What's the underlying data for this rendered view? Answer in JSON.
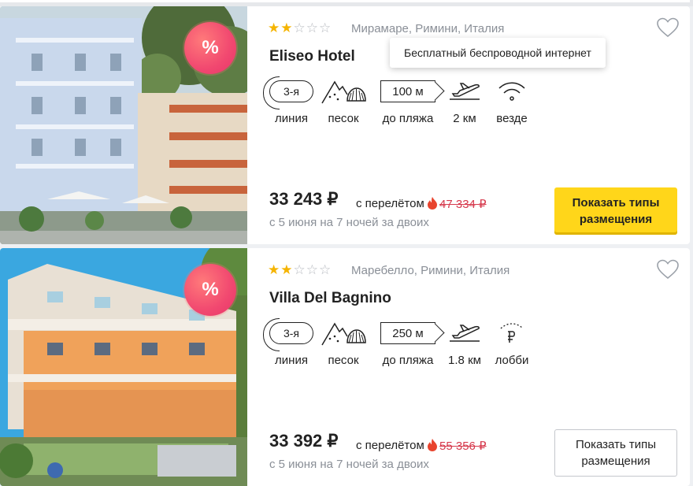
{
  "hotels": [
    {
      "stars_filled": 2,
      "stars_total": 5,
      "location": "Мирамаре, Римини, Италия",
      "name": "Eliseo Hotel",
      "discount_badge": "%",
      "features": {
        "line_value": "3-я",
        "line_label": "линия",
        "beach_label": "песок",
        "distance_value": "100 м",
        "distance_label": "до пляжа",
        "airport_label": "2 км",
        "wifi_label": "везде"
      },
      "tooltip": "Бесплатный беспроводной интернет",
      "price": "33 243 ₽",
      "price_note": "с перелётом",
      "old_price": "47 334 ₽",
      "dates": "с 5 июня на 7 ночей за двоих",
      "button_label": "Показать типы размещения"
    },
    {
      "stars_filled": 2,
      "stars_total": 5,
      "location": "Маребелло, Римини, Италия",
      "name": "Villa Del Bagnino",
      "discount_badge": "%",
      "features": {
        "line_value": "3-я",
        "line_label": "линия",
        "beach_label": "песок",
        "distance_value": "250 м",
        "distance_label": "до пляжа",
        "airport_label": "1.8 км",
        "wifi_label": "лобби"
      },
      "price": "33 392 ₽",
      "price_note": "с перелётом",
      "old_price": "55 356 ₽",
      "dates": "с 5 июня на 7 ночей за двоих",
      "button_label": "Показать типы размещения"
    }
  ],
  "colors": {
    "star": "#f5b400",
    "old_price": "#d63a4d",
    "primary_button": "#ffd61a",
    "badge": "#f14870"
  },
  "icons": [
    "heart-icon",
    "star-icon",
    "beach-icon",
    "distance-sign-icon",
    "airplane-icon",
    "wifi-icon",
    "paid-wifi-icon",
    "fire-icon"
  ]
}
